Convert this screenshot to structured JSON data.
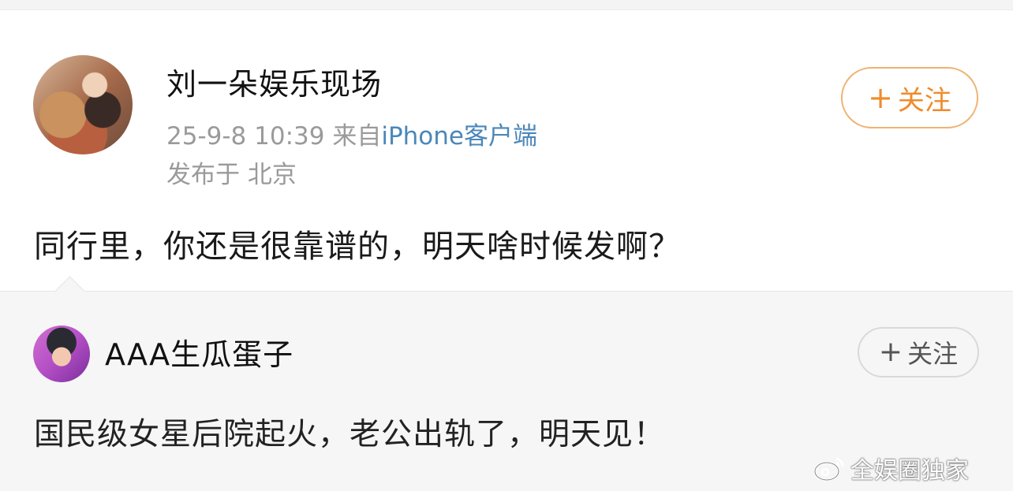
{
  "post": {
    "author": "刘一朵娱乐现场",
    "time": "25-9-8 10:39",
    "source_prefix": "来自",
    "source_app": "iPhone客户端",
    "location": "发布于 北京",
    "follow_plus": "+",
    "follow_label": "关注",
    "text": "同行里，你还是很靠谱的，明天啥时候发啊？"
  },
  "repost": {
    "author": "AAA生瓜蛋子",
    "follow_plus": "+",
    "follow_label": "关注",
    "text": "国民级女星后院起火，老公出轨了，明天见！"
  },
  "watermark": {
    "text": "全娱圈独家",
    "logo_icon": "weibo-logo-icon"
  },
  "colors": {
    "follow_accent": "#ef8b2c",
    "source_link": "#4b87b9",
    "meta_gray": "#9a9a9a"
  }
}
